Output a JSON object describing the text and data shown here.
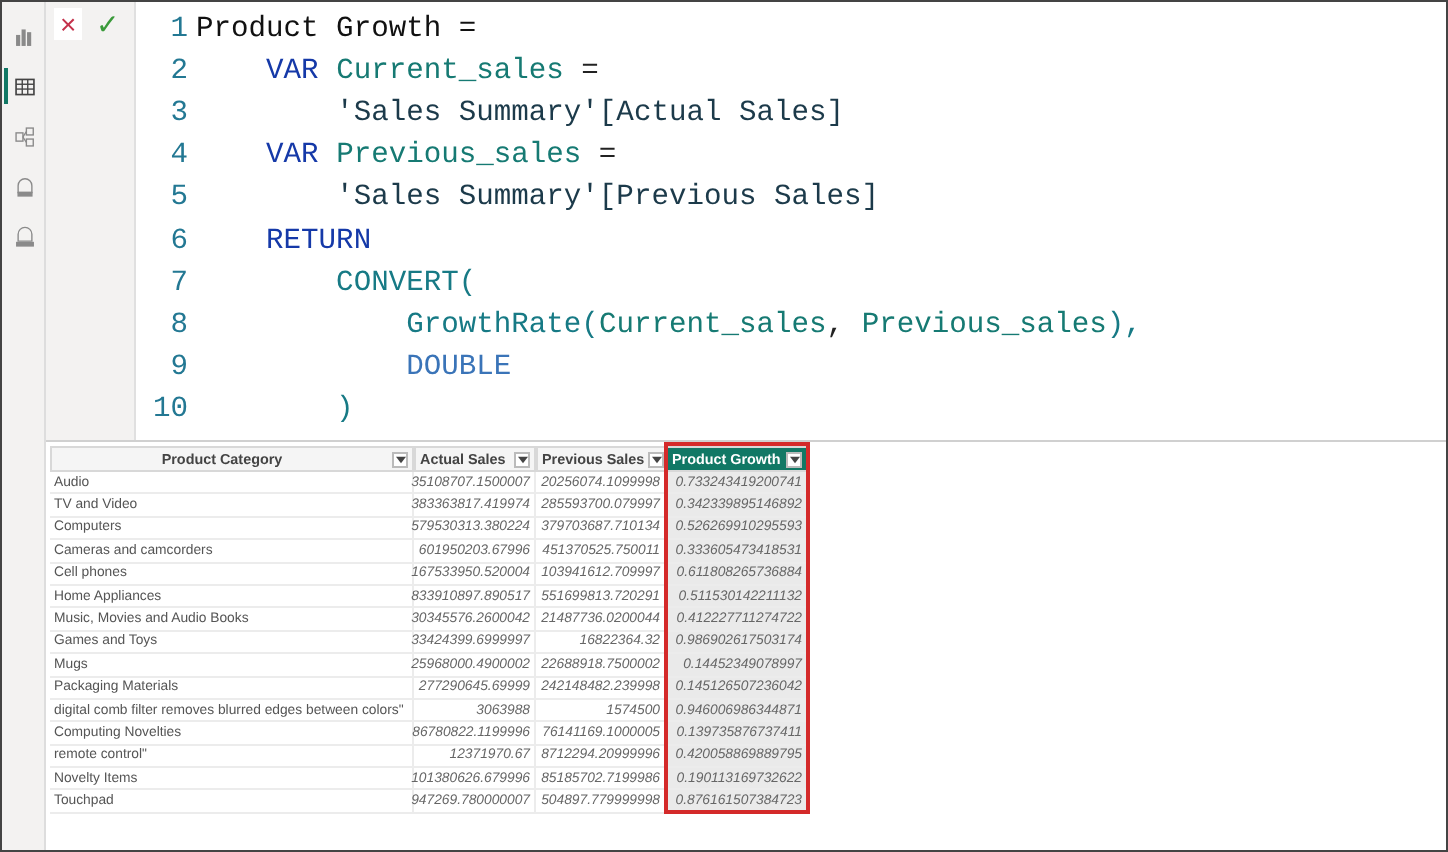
{
  "sidebar": {
    "items": [
      {
        "kind": "report",
        "selected": false
      },
      {
        "kind": "table",
        "selected": true
      },
      {
        "kind": "model",
        "selected": false
      },
      {
        "kind": "query",
        "selected": false
      },
      {
        "kind": "tmdl",
        "selected": false
      }
    ]
  },
  "formula_bar": {
    "cancel": "×",
    "commit": "✓",
    "lines": [
      {
        "number": "1",
        "tokens": [
          {
            "kind": "name",
            "text": "Product Growth ="
          }
        ]
      },
      {
        "number": "2",
        "tokens": [
          {
            "kind": "keyword",
            "text": "    VAR "
          },
          {
            "kind": "variable",
            "text": "Current_sales"
          },
          {
            "kind": "plain",
            "text": " ="
          }
        ]
      },
      {
        "number": "3",
        "tokens": [
          {
            "kind": "column",
            "text": "        'Sales Summary'[Actual Sales]"
          }
        ]
      },
      {
        "number": "4",
        "tokens": [
          {
            "kind": "keyword",
            "text": "    VAR "
          },
          {
            "kind": "variable",
            "text": "Previous_sales"
          },
          {
            "kind": "plain",
            "text": " ="
          }
        ]
      },
      {
        "number": "5",
        "tokens": [
          {
            "kind": "column",
            "text": "        'Sales Summary'[Previous Sales]"
          }
        ]
      },
      {
        "number": "6",
        "tokens": [
          {
            "kind": "keyword",
            "text": "    RETURN"
          }
        ]
      },
      {
        "number": "7",
        "tokens": [
          {
            "kind": "function",
            "text": "        CONVERT("
          }
        ]
      },
      {
        "number": "8",
        "tokens": [
          {
            "kind": "function",
            "text": "            GrowthRate("
          },
          {
            "kind": "variable",
            "text": "Current_sales"
          },
          {
            "kind": "plain",
            "text": ", "
          },
          {
            "kind": "variable",
            "text": "Previous_sales"
          },
          {
            "kind": "function",
            "text": "),"
          }
        ]
      },
      {
        "number": "9",
        "tokens": [
          {
            "kind": "constant",
            "text": "            DOUBLE"
          }
        ]
      },
      {
        "number": "10",
        "tokens": [
          {
            "kind": "function",
            "text": "        )"
          }
        ]
      }
    ]
  },
  "table": {
    "columns": [
      {
        "label": "Product Category",
        "selected": false
      },
      {
        "label": "Actual Sales",
        "selected": false
      },
      {
        "label": "Previous Sales",
        "selected": false
      },
      {
        "label": "Product Growth",
        "selected": true
      }
    ],
    "rows": [
      [
        "Audio",
        "35108707.1500007",
        "20256074.1099998",
        "0.733243419200741"
      ],
      [
        "TV and Video",
        "383363817.419974",
        "285593700.079997",
        "0.342339895146892"
      ],
      [
        "Computers",
        "579530313.380224",
        "379703687.710134",
        "0.526269910295593"
      ],
      [
        "Cameras and camcorders",
        "601950203.67996",
        "451370525.750011",
        "0.333605473418531"
      ],
      [
        "Cell phones",
        "167533950.520004",
        "103941612.709997",
        "0.611808265736884"
      ],
      [
        "Home Appliances",
        "833910897.890517",
        "551699813.720291",
        "0.511530142211132"
      ],
      [
        "Music, Movies and Audio Books",
        "30345576.2600042",
        "21487736.0200044",
        "0.412227711274722"
      ],
      [
        "Games and Toys",
        "33424399.6999997",
        "16822364.32",
        "0.986902617503174"
      ],
      [
        "Mugs",
        "25968000.4900002",
        "22688918.7500002",
        "0.14452349078997"
      ],
      [
        "Packaging Materials",
        "277290645.69999",
        "242148482.239998",
        "0.145126507236042"
      ],
      [
        " digital comb filter removes blurred edges between colors\"",
        "3063988",
        "1574500",
        "0.946006986344871"
      ],
      [
        "Computing Novelties",
        "86780822.1199996",
        "76141169.1000005",
        "0.139735876737411"
      ],
      [
        " remote control\"",
        "12371970.67",
        "8712294.20999996",
        "0.420058869889795"
      ],
      [
        "Novelty Items",
        "101380626.679996",
        "85185702.7199986",
        "0.190113169732622"
      ],
      [
        " Touchpad",
        "947269.780000007",
        "504897.779999998",
        "0.876161507384723"
      ]
    ]
  }
}
